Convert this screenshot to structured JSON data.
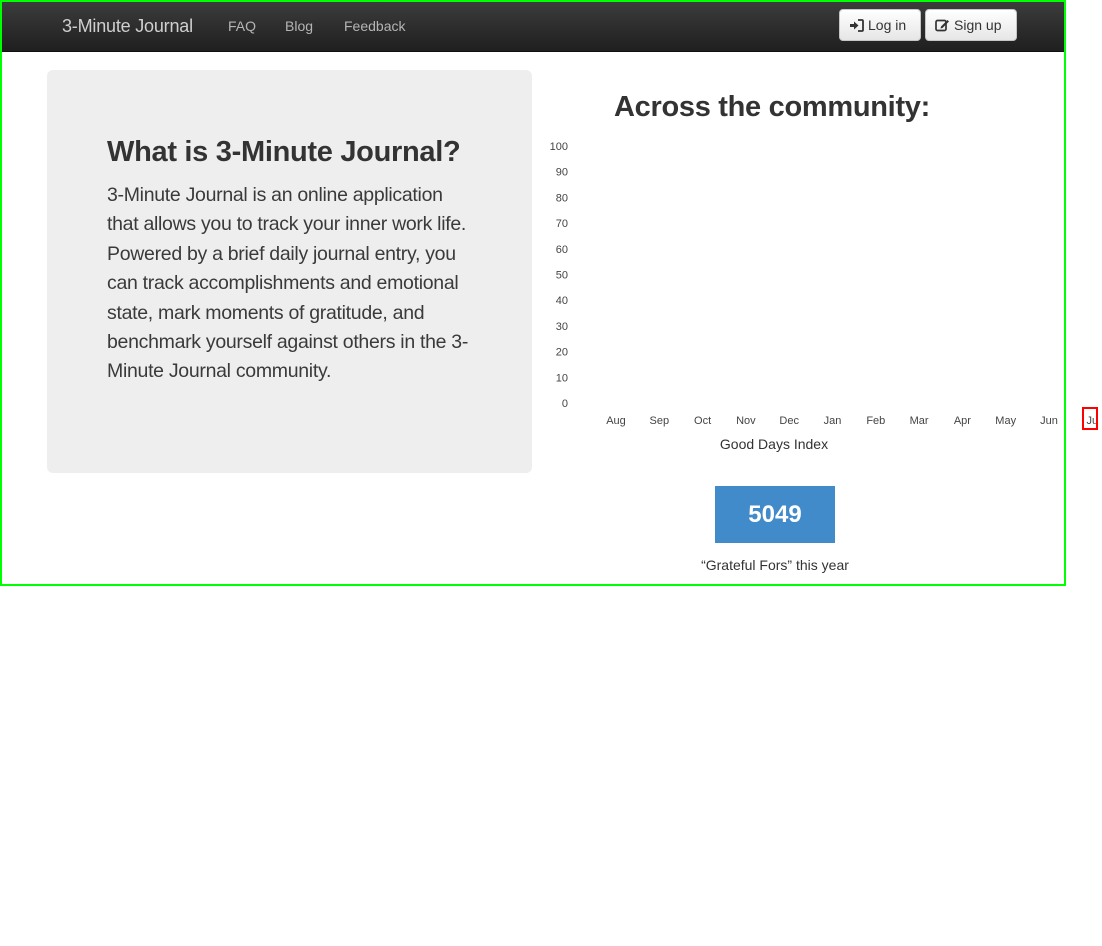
{
  "navbar": {
    "brand": "3-Minute Journal",
    "links": [
      "FAQ",
      "Blog",
      "Feedback"
    ],
    "login_label": "Log in",
    "signup_label": "Sign up"
  },
  "hero": {
    "title": "What is 3-Minute Journal?",
    "body": "3-Minute Journal is an online application that allows you to track your inner work life. Powered by a brief daily journal entry, you can track accomplishments and emotional state, mark moments of gratitude, and benchmark yourself against others in the 3-Minute Journal community."
  },
  "community": {
    "title": "Across the community:",
    "stat_value": "5049",
    "stat_label": "“Grateful Fors” this year",
    "stat_color": "#428bca"
  },
  "chart_data": {
    "type": "line",
    "categories": [
      "Aug",
      "Sep",
      "Oct",
      "Nov",
      "Dec",
      "Jan",
      "Feb",
      "Mar",
      "Apr",
      "May",
      "Jun",
      "Ju"
    ],
    "series": [],
    "xlabel": "Good Days Index",
    "ylabel": "",
    "ylim": [
      0,
      100
    ],
    "yticks": [
      0,
      10,
      20,
      30,
      40,
      50,
      60,
      70,
      80,
      90,
      100
    ],
    "grid": false
  },
  "colors": {
    "navbar_bg": "#2b2b2b",
    "hero_bg": "#eeeeee",
    "frame_outline": "#00ff00",
    "highlight_outline": "#ff0000"
  },
  "icons": {
    "login": "sign-in-icon",
    "signup": "edit-icon"
  }
}
